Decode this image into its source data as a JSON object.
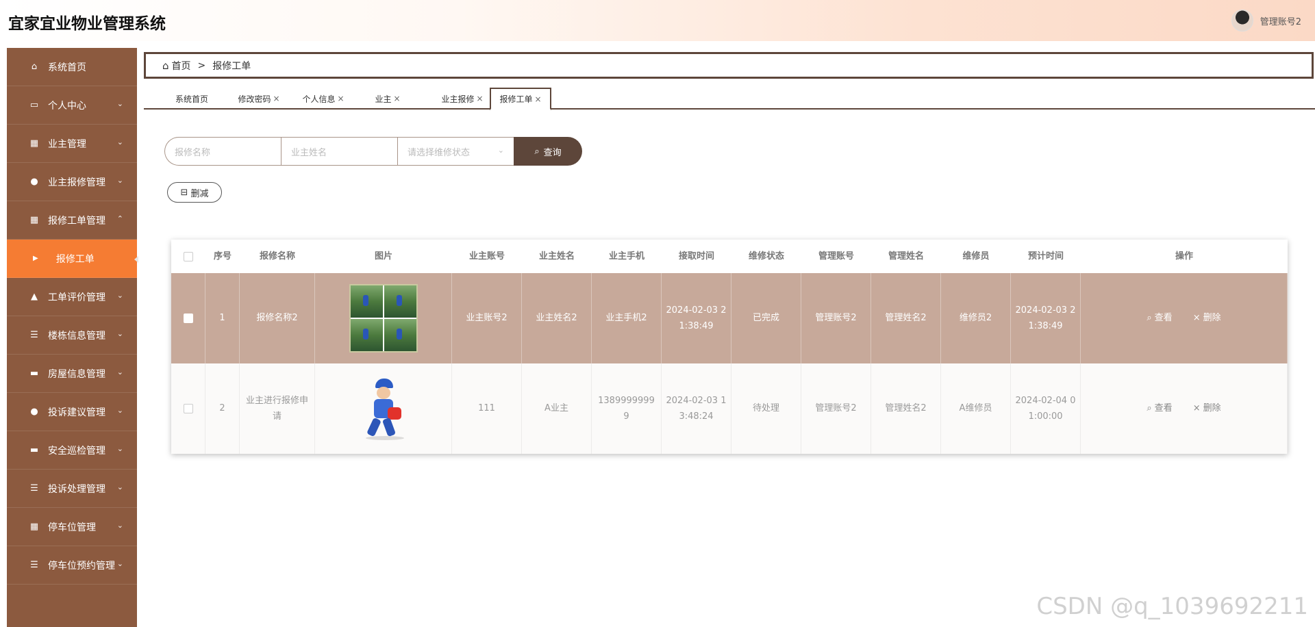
{
  "app": {
    "title": "宜家宜业物业管理系统",
    "user_label": "管理账号2"
  },
  "sidebar": {
    "items": [
      {
        "label": "系统首页",
        "icon": "home-icon",
        "glyph": "⌂",
        "chevron": ""
      },
      {
        "label": "个人中心",
        "icon": "id-card-icon",
        "glyph": "▭",
        "chevron": "⌄"
      },
      {
        "label": "业主管理",
        "icon": "grid-icon",
        "glyph": "▦",
        "chevron": "⌄"
      },
      {
        "label": "业主报修管理",
        "icon": "user-icon",
        "glyph": "●",
        "chevron": "⌄"
      },
      {
        "label": "报修工单管理",
        "icon": "grid-icon",
        "glyph": "▦",
        "chevron": "⌃"
      },
      {
        "label": "报修工单",
        "icon": "caret-right-icon",
        "glyph": "▶",
        "chevron": ""
      },
      {
        "label": "工单评价管理",
        "icon": "thumb-up-icon",
        "glyph": "▲",
        "chevron": "⌄"
      },
      {
        "label": "楼栋信息管理",
        "icon": "list-icon",
        "glyph": "☰",
        "chevron": "⌄"
      },
      {
        "label": "房屋信息管理",
        "icon": "ticket-icon",
        "glyph": "▬",
        "chevron": "⌄"
      },
      {
        "label": "投诉建议管理",
        "icon": "user-icon",
        "glyph": "●",
        "chevron": "⌄"
      },
      {
        "label": "安全巡检管理",
        "icon": "monitor-icon",
        "glyph": "▬",
        "chevron": "⌄"
      },
      {
        "label": "投诉处理管理",
        "icon": "sliders-icon",
        "glyph": "☰",
        "chevron": "⌄"
      },
      {
        "label": "停车位管理",
        "icon": "grid-icon",
        "glyph": "▦",
        "chevron": "⌄"
      },
      {
        "label": "停车位预约管理",
        "icon": "list-icon",
        "glyph": "☰",
        "chevron": "⌄"
      }
    ]
  },
  "breadcrumb": {
    "home": "首页",
    "separator": ">",
    "current": "报修工单"
  },
  "tabs": [
    {
      "label": "系统首页",
      "close": ""
    },
    {
      "label": "修改密码",
      "close": "×"
    },
    {
      "label": "个人信息",
      "close": "×"
    },
    {
      "label": "业主",
      "close": "×"
    },
    {
      "label": "业主报修",
      "close": "×"
    },
    {
      "label": "报修工单",
      "close": "×"
    }
  ],
  "search": {
    "name_placeholder": "报修名称",
    "owner_placeholder": "业主姓名",
    "status_placeholder": "请选择维修状态",
    "query_button": "查询"
  },
  "actions": {
    "delete_button": "删减"
  },
  "table": {
    "columns": [
      "序号",
      "报修名称",
      "图片",
      "业主账号",
      "业主姓名",
      "业主手机",
      "接取时间",
      "维修状态",
      "管理账号",
      "管理姓名",
      "维修员",
      "预计时间",
      "操作"
    ],
    "rows": [
      {
        "index": "1",
        "name": "报修名称2",
        "image": "repair-photo-grid",
        "owner_account": "业主账号2",
        "owner_name": "业主姓名2",
        "owner_phone": "业主手机2",
        "accept_time": "2024-02-03 21:38:49",
        "status": "已完成",
        "admin_account": "管理账号2",
        "admin_name": "管理姓名2",
        "repairman": "维修员2",
        "expected_time": "2024-02-03 21:38:49",
        "view": "查看",
        "delete": "删除"
      },
      {
        "index": "2",
        "name": "业主进行报修申请",
        "image": "repairman-cartoon",
        "owner_account": "111",
        "owner_name": "A业主",
        "owner_phone": "13899999999",
        "accept_time": "2024-02-03 13:48:24",
        "status": "待处理",
        "admin_account": "管理账号2",
        "admin_name": "管理姓名2",
        "repairman": "A维修员",
        "expected_time": "2024-02-04 01:00:00",
        "view": "查看",
        "delete": "删除"
      }
    ]
  },
  "watermark": "CSDN @q_1039692211",
  "colors": {
    "sidebar": "#8c5a3f",
    "active_item": "#f57c33",
    "primary_dark": "#5d463a",
    "selected_row": "#c7a99a"
  }
}
